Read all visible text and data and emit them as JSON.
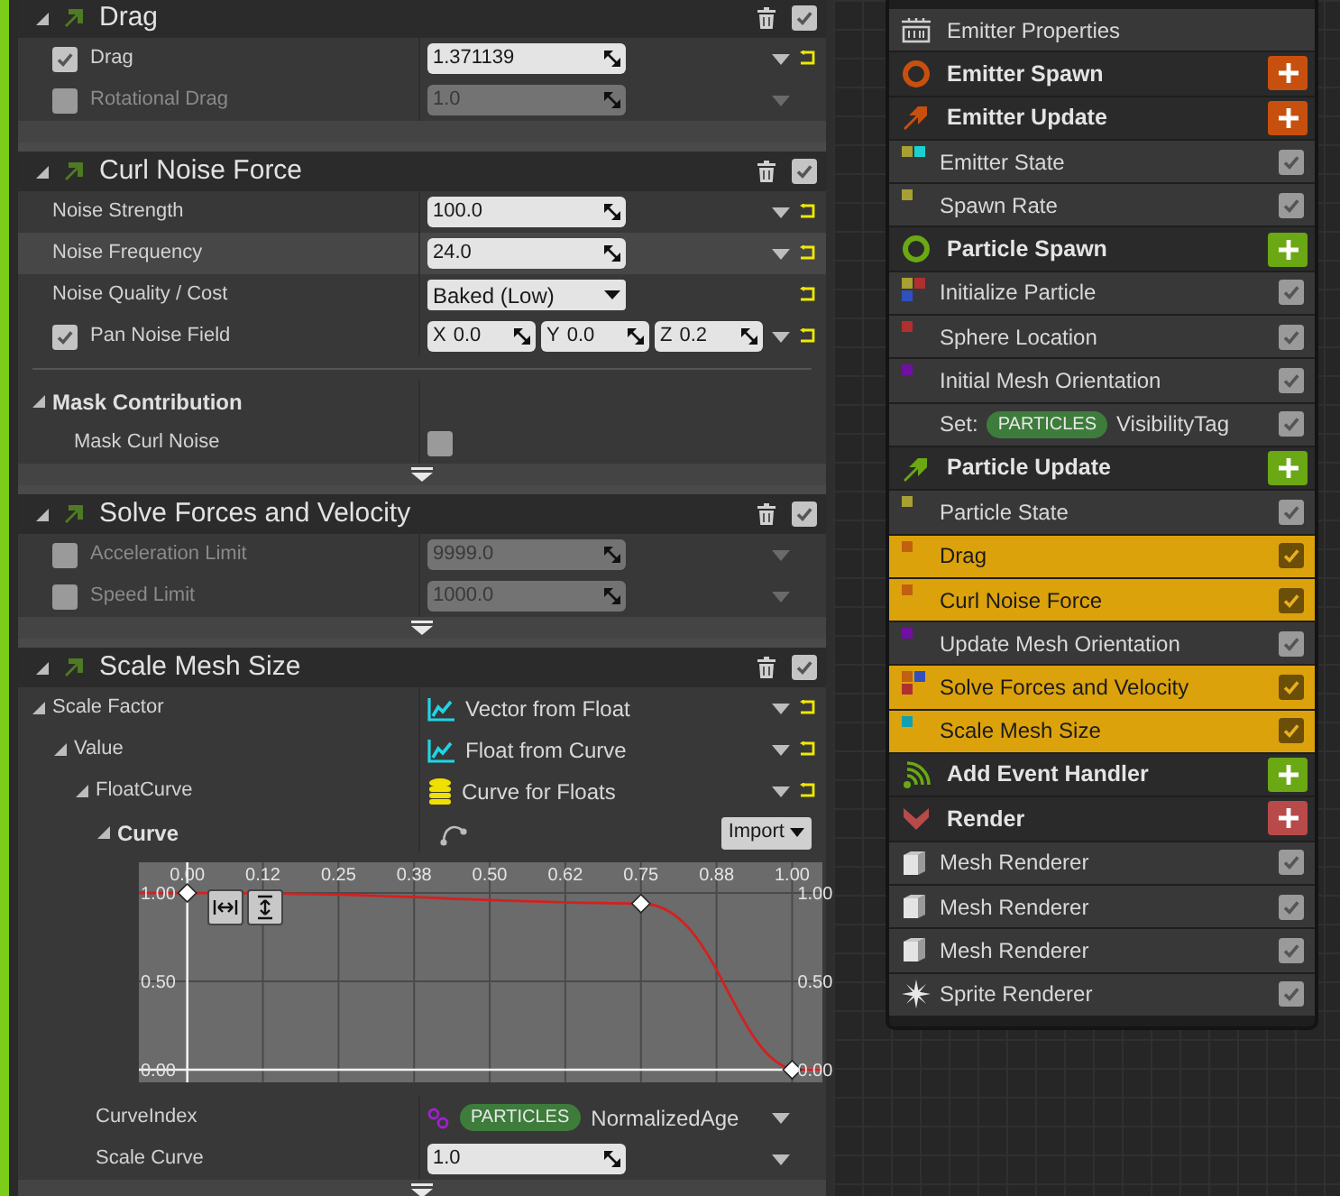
{
  "sections": [
    {
      "title": "Drag",
      "enabled": true,
      "more": false,
      "rows": [
        {
          "kind": "number",
          "label": "Drag",
          "checked": true,
          "value": "1.371139",
          "disabled": false,
          "highlighted": false,
          "menu": true,
          "reset": true
        },
        {
          "kind": "number",
          "label": "Rotational Drag",
          "checked": false,
          "value": "1.0",
          "disabled": true,
          "highlighted": false,
          "menu": true,
          "reset": false
        }
      ]
    },
    {
      "title": "Curl Noise Force",
      "enabled": true,
      "more": true,
      "rows": [
        {
          "kind": "number",
          "label": "Noise Strength",
          "value": "100.0",
          "disabled": false,
          "highlighted": false,
          "menu": true,
          "reset": true
        },
        {
          "kind": "number",
          "label": "Noise Frequency",
          "value": "24.0",
          "disabled": false,
          "highlighted": true,
          "menu": true,
          "reset": true
        },
        {
          "kind": "dropdown",
          "label": "Noise Quality / Cost",
          "value": "Baked (Low)",
          "disabled": false,
          "highlighted": false,
          "menu": false,
          "reset": true
        },
        {
          "kind": "vector",
          "label": "Pan Noise Field",
          "checked": true,
          "components": [
            {
              "axis": "X",
              "value": "0.0"
            },
            {
              "axis": "Y",
              "value": "0.0"
            },
            {
              "axis": "Z",
              "value": "0.2"
            }
          ],
          "disabled": false,
          "highlighted": false,
          "menu": true,
          "reset": true
        },
        {
          "kind": "group",
          "label": "Mask Contribution",
          "expanded": true,
          "disabled": false,
          "highlighted": false,
          "menu": false,
          "reset": false,
          "children": [
            {
              "kind": "bool",
              "label": "Mask Curl Noise",
              "on": false,
              "disabled": false,
              "highlighted": false,
              "menu": false,
              "reset": false
            }
          ]
        }
      ]
    },
    {
      "title": "Solve Forces and Velocity",
      "enabled": true,
      "more": true,
      "rows": [
        {
          "kind": "number",
          "label": "Acceleration Limit",
          "checked": false,
          "value": "9999.0",
          "disabled": true,
          "highlighted": false,
          "menu": true,
          "reset": false
        },
        {
          "kind": "number",
          "label": "Speed Limit",
          "checked": false,
          "value": "1000.0",
          "disabled": true,
          "highlighted": false,
          "menu": true,
          "reset": false
        }
      ]
    },
    {
      "title": "Scale Mesh Size",
      "enabled": true,
      "more": true,
      "rows": [
        {
          "kind": "function_link",
          "label": "Scale Factor",
          "value": "Vector from Float",
          "expanded": true,
          "disabled": false,
          "highlighted": false,
          "menu": true,
          "reset": true,
          "children": [
            {
              "kind": "function_link",
              "label": "Value",
              "value": "Float from Curve",
              "expanded": true,
              "disabled": false,
              "highlighted": false,
              "menu": true,
              "reset": true,
              "children": [
                {
                  "kind": "asset_link",
                  "label": "FloatCurve",
                  "value": "Curve for Floats",
                  "expanded": true,
                  "disabled": false,
                  "highlighted": false,
                  "menu": true,
                  "reset": true,
                  "children": [
                    {
                      "kind": "curve",
                      "label": "Curve",
                      "expanded": true,
                      "button": "Import",
                      "disabled": false,
                      "highlighted": false,
                      "right_labels": [
                        "1.00",
                        "0.50",
                        "0.00"
                      ],
                      "chart_data": {
                        "type": "line",
                        "x": [
                          0,
                          0.75,
                          1
                        ],
                        "series": [
                          {
                            "color": "#d42020",
                            "marker": "diamond",
                            "values": [
                              1,
                              0.94,
                              0
                            ]
                          }
                        ],
                        "xlim": [
                          -0.08,
                          1.05
                        ],
                        "ylim": [
                          0,
                          1
                        ],
                        "grid": true,
                        "xticks": [
                          {
                            "value": 0,
                            "label": "0.00"
                          },
                          {
                            "value": 0.125,
                            "label": "0.12"
                          },
                          {
                            "value": 0.25,
                            "label": "0.25"
                          },
                          {
                            "value": 0.375,
                            "label": "0.38"
                          },
                          {
                            "value": 0.5,
                            "label": "0.50"
                          },
                          {
                            "value": 0.625,
                            "label": "0.62"
                          },
                          {
                            "value": 0.75,
                            "label": "0.75"
                          },
                          {
                            "value": 0.875,
                            "label": "0.88"
                          },
                          {
                            "value": 1,
                            "label": "1.00"
                          }
                        ],
                        "yticks": [
                          {
                            "value": 0,
                            "label": "0.00"
                          },
                          {
                            "value": 0.5,
                            "label": "0.50"
                          },
                          {
                            "value": 1,
                            "label": "1.00"
                          }
                        ]
                      }
                    }
                  ]
                },
                {
                  "kind": "param",
                  "label": "CurveIndex",
                  "tag": "PARTICLES",
                  "value": "NormalizedAge",
                  "disabled": false,
                  "highlighted": false,
                  "menu": true,
                  "reset": false
                },
                {
                  "kind": "number",
                  "label": "Scale Curve",
                  "value": "1.0",
                  "disabled": false,
                  "highlighted": false,
                  "menu": true,
                  "reset": false
                }
              ]
            }
          ]
        }
      ]
    }
  ],
  "stack": [
    {
      "kind": "properties",
      "label": "Emitter Properties"
    },
    {
      "kind": "spawn_stage",
      "label": "Emitter Spawn",
      "color": "#c8500e"
    },
    {
      "kind": "update_stage",
      "label": "Emitter Update",
      "color": "#c8500e"
    },
    {
      "kind": "module",
      "label": "Emitter State",
      "dots": [
        {
          "color": "#a8a032"
        },
        {
          "color": "#1ad1d1"
        }
      ],
      "checked": true,
      "selected": false
    },
    {
      "kind": "module",
      "label": "Spawn Rate",
      "dots": [
        {
          "color": "#a8a032"
        }
      ],
      "checked": true,
      "selected": false
    },
    {
      "kind": "spawn_stage",
      "label": "Particle Spawn",
      "color": "#6aa814"
    },
    {
      "kind": "module",
      "label": "Initialize Particle",
      "dots": [
        {
          "color": "#a8a032"
        },
        {
          "color": "#b03030"
        },
        {
          "color": "#3050c0"
        }
      ],
      "checked": true,
      "selected": false
    },
    {
      "kind": "module",
      "label": "Sphere Location",
      "dots": [
        {
          "color": "#b03030"
        }
      ],
      "checked": true,
      "selected": false
    },
    {
      "kind": "module",
      "label": "Initial Mesh Orientation",
      "dots": [
        {
          "color": "#7010a0"
        }
      ],
      "checked": true,
      "selected": false
    },
    {
      "kind": "set",
      "prefix": "Set:",
      "tag": "PARTICLES",
      "label": "VisibilityTag",
      "checked": true,
      "selected": false
    },
    {
      "kind": "update_stage",
      "label": "Particle Update",
      "color": "#6aa814"
    },
    {
      "kind": "module",
      "label": "Particle State",
      "dots": [
        {
          "color": "#a8a032"
        }
      ],
      "checked": true,
      "selected": false
    },
    {
      "kind": "module",
      "label": "Drag",
      "dots": [
        {
          "color": "#c06010"
        }
      ],
      "checked": true,
      "selected": true
    },
    {
      "kind": "module",
      "label": "Curl Noise Force",
      "dots": [
        {
          "color": "#c06010"
        }
      ],
      "checked": true,
      "selected": true
    },
    {
      "kind": "module",
      "label": "Update Mesh Orientation",
      "dots": [
        {
          "color": "#7010a0"
        }
      ],
      "checked": true,
      "selected": false
    },
    {
      "kind": "module",
      "label": "Solve Forces and Velocity",
      "dots": [
        {
          "color": "#c06010"
        },
        {
          "color": "#3050c0"
        },
        {
          "color": "#b03030"
        }
      ],
      "checked": true,
      "selected": true
    },
    {
      "kind": "module",
      "label": "Scale Mesh Size",
      "dots": [
        {
          "color": "#10a0b0"
        }
      ],
      "checked": true,
      "selected": true
    },
    {
      "kind": "event_stage",
      "label": "Add Event Handler",
      "color": "#6aa814"
    },
    {
      "kind": "render_stage",
      "label": "Render",
      "color": "#b94a4a"
    },
    {
      "kind": "mesh_renderer",
      "label": "Mesh Renderer",
      "checked": true,
      "selected": false
    },
    {
      "kind": "mesh_renderer",
      "label": "Mesh Renderer",
      "checked": true,
      "selected": false
    },
    {
      "kind": "mesh_renderer",
      "label": "Mesh Renderer",
      "checked": true,
      "selected": false
    },
    {
      "kind": "sprite_renderer",
      "label": "Sprite Renderer",
      "checked": true,
      "selected": false
    }
  ]
}
